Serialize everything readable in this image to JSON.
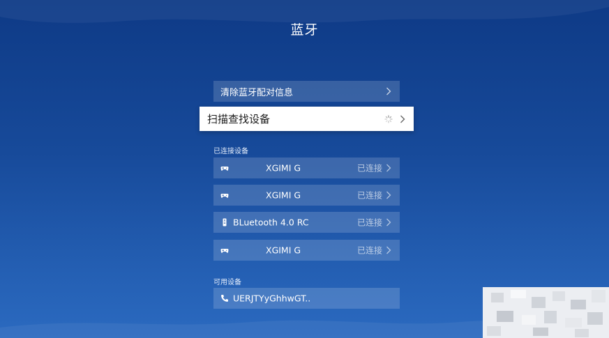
{
  "page": {
    "title": "蓝牙"
  },
  "menu": {
    "clear_pairing": "清除蓝牙配对信息",
    "scan_devices": "扫描查找设备"
  },
  "connected": {
    "section_label": "已连接设备",
    "devices": [
      {
        "name": "XGIMI G",
        "status": "已连接",
        "icon": "gamepad-icon"
      },
      {
        "name": "XGIMI G",
        "status": "已连接",
        "icon": "gamepad-icon"
      },
      {
        "name": "BLuetooth 4.0 RC",
        "status": "已连接",
        "icon": "remote-icon"
      },
      {
        "name": "XGIMI G",
        "status": "已连接",
        "icon": "gamepad-icon"
      }
    ]
  },
  "available": {
    "section_label": "可用设备",
    "devices": [
      {
        "name": "UERJTYyGhhwGT..",
        "icon": "phone-icon"
      }
    ]
  },
  "colors": {
    "background_top": "#0e3a86",
    "background_bottom": "#2b6ac0",
    "row_fill": "rgba(255,255,255,0.16)",
    "focused_row": "#ffffff"
  }
}
